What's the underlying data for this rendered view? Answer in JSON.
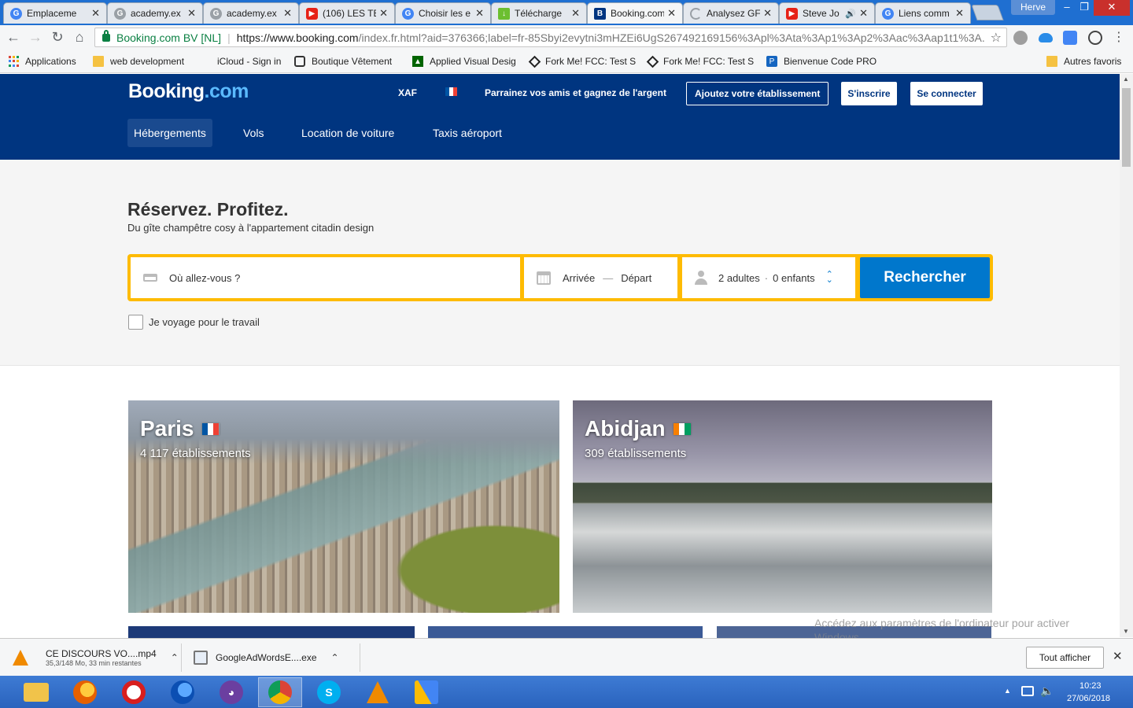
{
  "browser": {
    "tabs": [
      {
        "title": "Emplaceme",
        "favicon": "google-icon",
        "color": "#4285f4"
      },
      {
        "title": "academy.ex",
        "favicon": "google-icon",
        "color": "#9aa0a6"
      },
      {
        "title": "academy.ex",
        "favicon": "google-icon",
        "color": "#9aa0a6"
      },
      {
        "title": "(106) LES TE",
        "favicon": "youtube-icon",
        "color": "#e62117"
      },
      {
        "title": "Choisir les e",
        "favicon": "google-icon",
        "color": "#4285f4"
      },
      {
        "title": "Télécharge",
        "favicon": "download-icon",
        "color": "#6cbf30"
      },
      {
        "title": "Booking.com",
        "favicon": "booking-icon",
        "color": "#003580",
        "active": true
      },
      {
        "title": "Analysez GF",
        "favicon": "loading-icon",
        "color": "#9aa0a6"
      },
      {
        "title": "Steve Jo",
        "favicon": "youtube-icon",
        "color": "#e62117",
        "sound": true
      },
      {
        "title": "Liens comm",
        "favicon": "google-icon",
        "color": "#4285f4"
      }
    ],
    "profile_name": "Herve",
    "window_controls": {
      "minimize": "–",
      "maximize": "❐",
      "close": "✕"
    },
    "site_identity": "Booking.com BV [NL]",
    "url_host": "https://www.booking.com",
    "url_path": "/index.fr.html?aid=376366;label=fr-85Sbyi2evytni3mHZEi6UgS267492169156%3Apl%3Ata%3Ap1%3Ap2%3Aac%3Aap1t1%3A..."
  },
  "bookmarks": [
    {
      "label": "Applications",
      "icon": "apps-icon"
    },
    {
      "label": "web development",
      "icon": "folder-icon"
    },
    {
      "label": "iCloud - Sign in",
      "icon": "apple-icon"
    },
    {
      "label": "Boutique Vêtement",
      "icon": "camera-icon"
    },
    {
      "label": "Applied Visual Desig",
      "icon": "fcc-icon"
    },
    {
      "label": "Fork Me! FCC: Test S",
      "icon": "codepen-icon"
    },
    {
      "label": "Fork Me! FCC: Test S",
      "icon": "codepen-icon"
    },
    {
      "label": "Bienvenue Code PRO",
      "icon": "codepro-icon"
    },
    {
      "label": "Autres favoris",
      "icon": "folder-icon"
    }
  ],
  "header": {
    "logo_main": "Booking",
    "logo_tld": ".com",
    "currency": "XAF",
    "referral": "Parrainez vos amis et gagnez de l'argent",
    "add_property": "Ajoutez votre établissement",
    "signup": "S'inscrire",
    "signin": "Se connecter",
    "nav": [
      "Hébergements",
      "Vols",
      "Location de voiture",
      "Taxis aéroport"
    ]
  },
  "hero": {
    "title": "Réservez. Profitez.",
    "subtitle": "Du gîte champêtre cosy à l'appartement citadin design"
  },
  "search": {
    "destination_placeholder": "Où allez-vous ?",
    "checkin": "Arrivée",
    "date_separator": "—",
    "checkout": "Départ",
    "adults": "2 adultes",
    "guest_separator": "·",
    "children": "0 enfants",
    "button": "Rechercher",
    "work_travel": "Je voyage pour le travail"
  },
  "destinations": [
    {
      "name": "Paris",
      "count": "4 117 établissements",
      "flag": "france-flag"
    },
    {
      "name": "Abidjan",
      "count": "309 établissements",
      "flag": "cote-divoire-flag"
    }
  ],
  "watermark": {
    "line1": "Accédez aux paramètres de l'ordinateur pour activer",
    "line2": "Windows."
  },
  "downloads": [
    {
      "name": "CE DISCOURS VO....mp4",
      "status": "35,3/148 Mo, 33 min restantes",
      "icon": "vlc-icon"
    },
    {
      "name": "GoogleAdWordsE....exe",
      "status": "",
      "icon": "installer-icon"
    }
  ],
  "show_all": "Tout afficher",
  "taskbar": {
    "apps": [
      "explorer-icon",
      "firefox-icon",
      "opera-icon",
      "firefox-dev-icon",
      "cat-icon",
      "chrome-icon",
      "skype-icon",
      "vlc-icon",
      "adwords-icon"
    ],
    "time": "10:23",
    "date": "27/06/2018"
  },
  "colors": {
    "brand_blue": "#003580",
    "search_yellow": "#febb02",
    "button_blue": "#0077cc"
  }
}
